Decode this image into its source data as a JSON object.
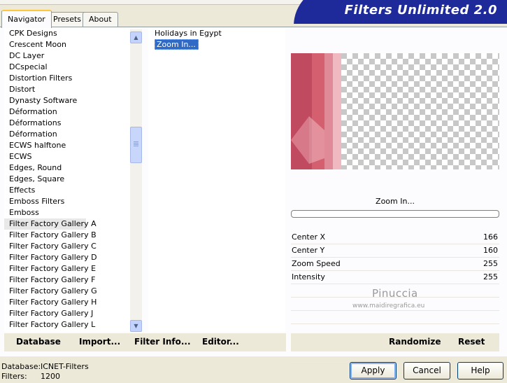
{
  "tabs": [
    {
      "label": "Navigator"
    },
    {
      "label": "Presets"
    },
    {
      "label": "About"
    }
  ],
  "banner_title": "Filters Unlimited 2.0",
  "categories": [
    "CPK Designs",
    "Crescent Moon",
    "DC Layer",
    "DCspecial",
    "Distortion Filters",
    "Distort",
    "Dynasty Software",
    "Déformation",
    "Déformations",
    "Déformation",
    "ECWS halftone",
    "ECWS",
    "Edges, Round",
    "Edges, Square",
    "Effects",
    "Emboss Filters",
    "Emboss",
    "Filter Factory Gallery A",
    "Filter Factory Gallery B",
    "Filter Factory Gallery C",
    "Filter Factory Gallery D",
    "Filter Factory Gallery E",
    "Filter Factory Gallery F",
    "Filter Factory Gallery G",
    "Filter Factory Gallery H",
    "Filter Factory Gallery J",
    "Filter Factory Gallery L"
  ],
  "selected_category": "Filter Factory Gallery A",
  "filters": [
    "Holidays in Egypt",
    "Zoom In..."
  ],
  "selected_filter": "Zoom In...",
  "filter_name": "Zoom In...",
  "params": [
    {
      "label": "Center X",
      "value": "166"
    },
    {
      "label": "Center Y",
      "value": "160"
    },
    {
      "label": "Zoom Speed",
      "value": "255"
    },
    {
      "label": "Intensity",
      "value": "255"
    }
  ],
  "watermark": {
    "name": "Pinuccia",
    "url": "www.maidiregrafica.eu"
  },
  "toolbar_left": {
    "database": "Database",
    "import": "Import...",
    "filter_info": "Filter Info...",
    "editor": "Editor..."
  },
  "toolbar_right": {
    "randomize": "Randomize",
    "reset": "Reset"
  },
  "status": {
    "database_label": "Database:",
    "database_value": "ICNET-Filters",
    "filters_label": "Filters:",
    "filters_value": "1200"
  },
  "buttons": {
    "apply": "Apply",
    "cancel": "Cancel",
    "help": "Help"
  },
  "colors": {
    "banner_blue": "#1e2a9a",
    "selection_blue": "#316ac5",
    "preview_pink_dark": "#c04a60",
    "preview_pink_light": "#e08a98",
    "preview_pink_pale": "#f0b8c0"
  }
}
